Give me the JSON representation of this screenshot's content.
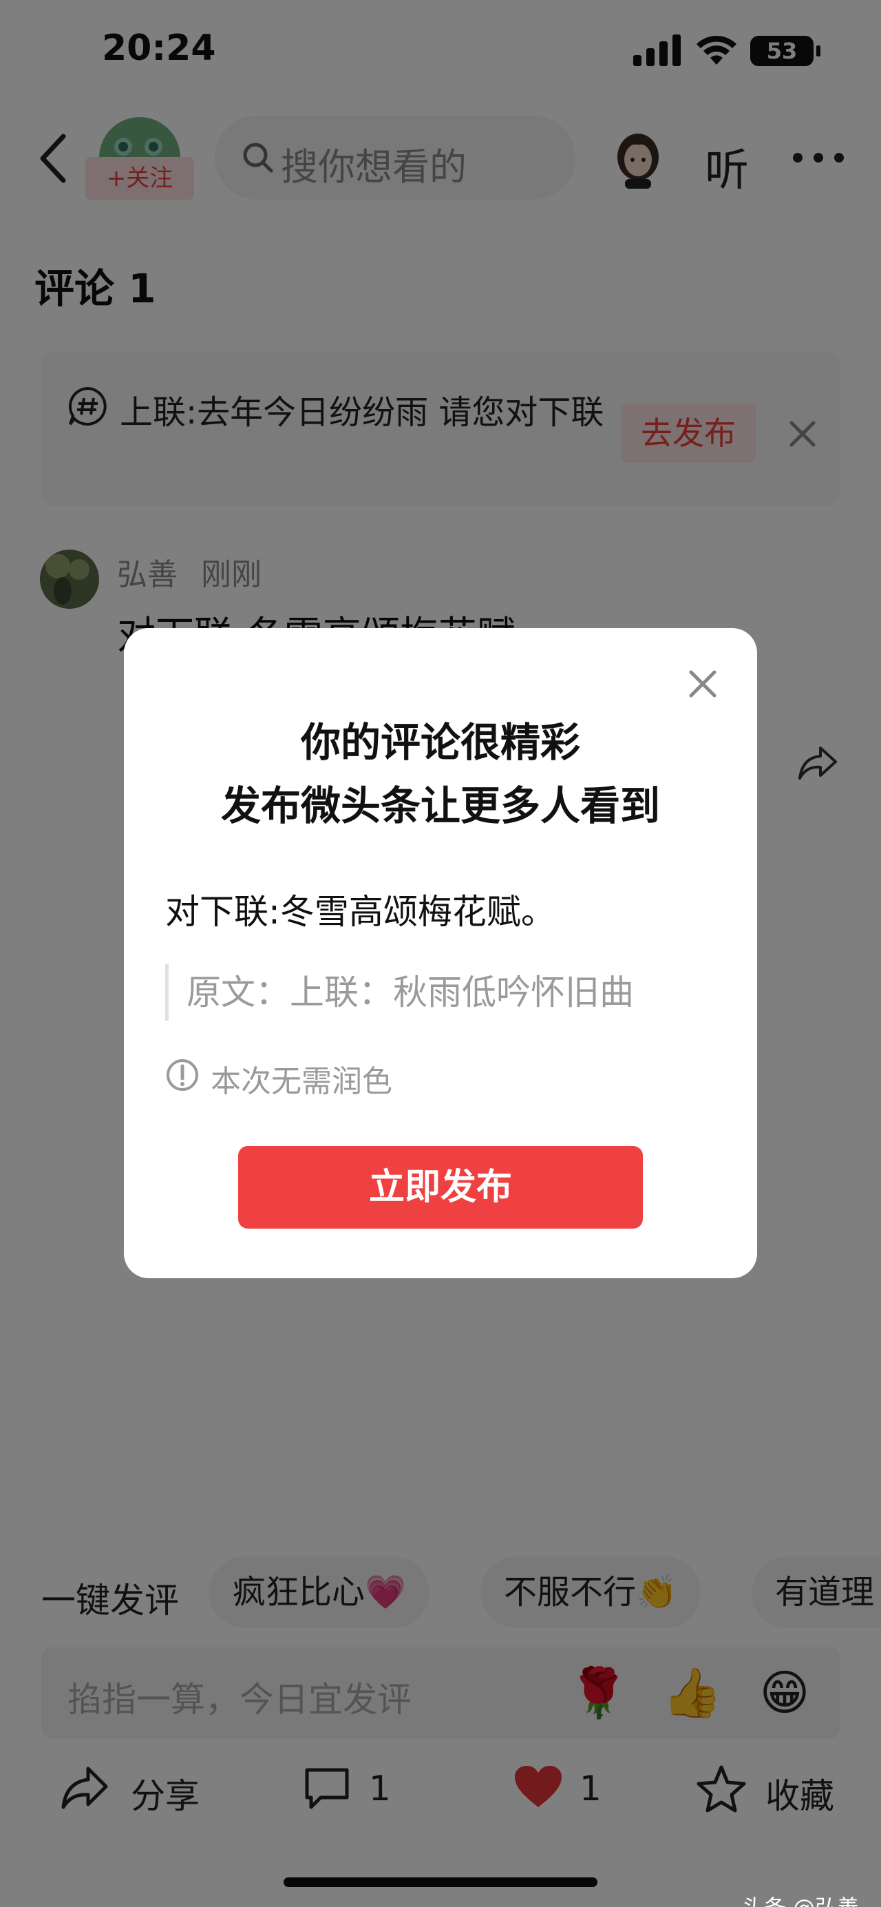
{
  "status_bar": {
    "time": "20:24",
    "battery": "53"
  },
  "header": {
    "follow_label": "+关注",
    "search_placeholder": "搜你想看的",
    "listen_label": "听"
  },
  "comments": {
    "title": "评论 1"
  },
  "couplet_banner": {
    "text": "上联:去年今日纷纷雨 请您对下联",
    "publish_label": "去发布"
  },
  "comment": {
    "user": "弘善",
    "time": "刚刚",
    "body": "对下联:冬雪高颂梅花赋。"
  },
  "dialog": {
    "title_line1": "你的评论很精彩",
    "title_line2": "发布微头条让更多人看到",
    "comment_text": "对下联:冬雪高颂梅花赋。",
    "quote_text": "原文：上联：秋雨低吟怀旧曲",
    "note": "本次无需润色",
    "publish_button": "立即发布"
  },
  "quick_reply": {
    "label": "一键发评",
    "chips": [
      "疯狂比心💗",
      "不服不行👏",
      "有道理"
    ]
  },
  "comment_input": {
    "placeholder": "掐指一算，今日宜发评",
    "emojis": [
      "🌹",
      "👍",
      "😁"
    ]
  },
  "action_bar": {
    "share_label": "分享",
    "comment_count": "1",
    "like_count": "1",
    "favorite_label": "收藏"
  },
  "watermark": "头条 @弘善",
  "colors": {
    "accent_red": "#f04142",
    "chip_red_bg": "#fde3e3",
    "overlay": "rgba(0,0,0,0.5)"
  }
}
